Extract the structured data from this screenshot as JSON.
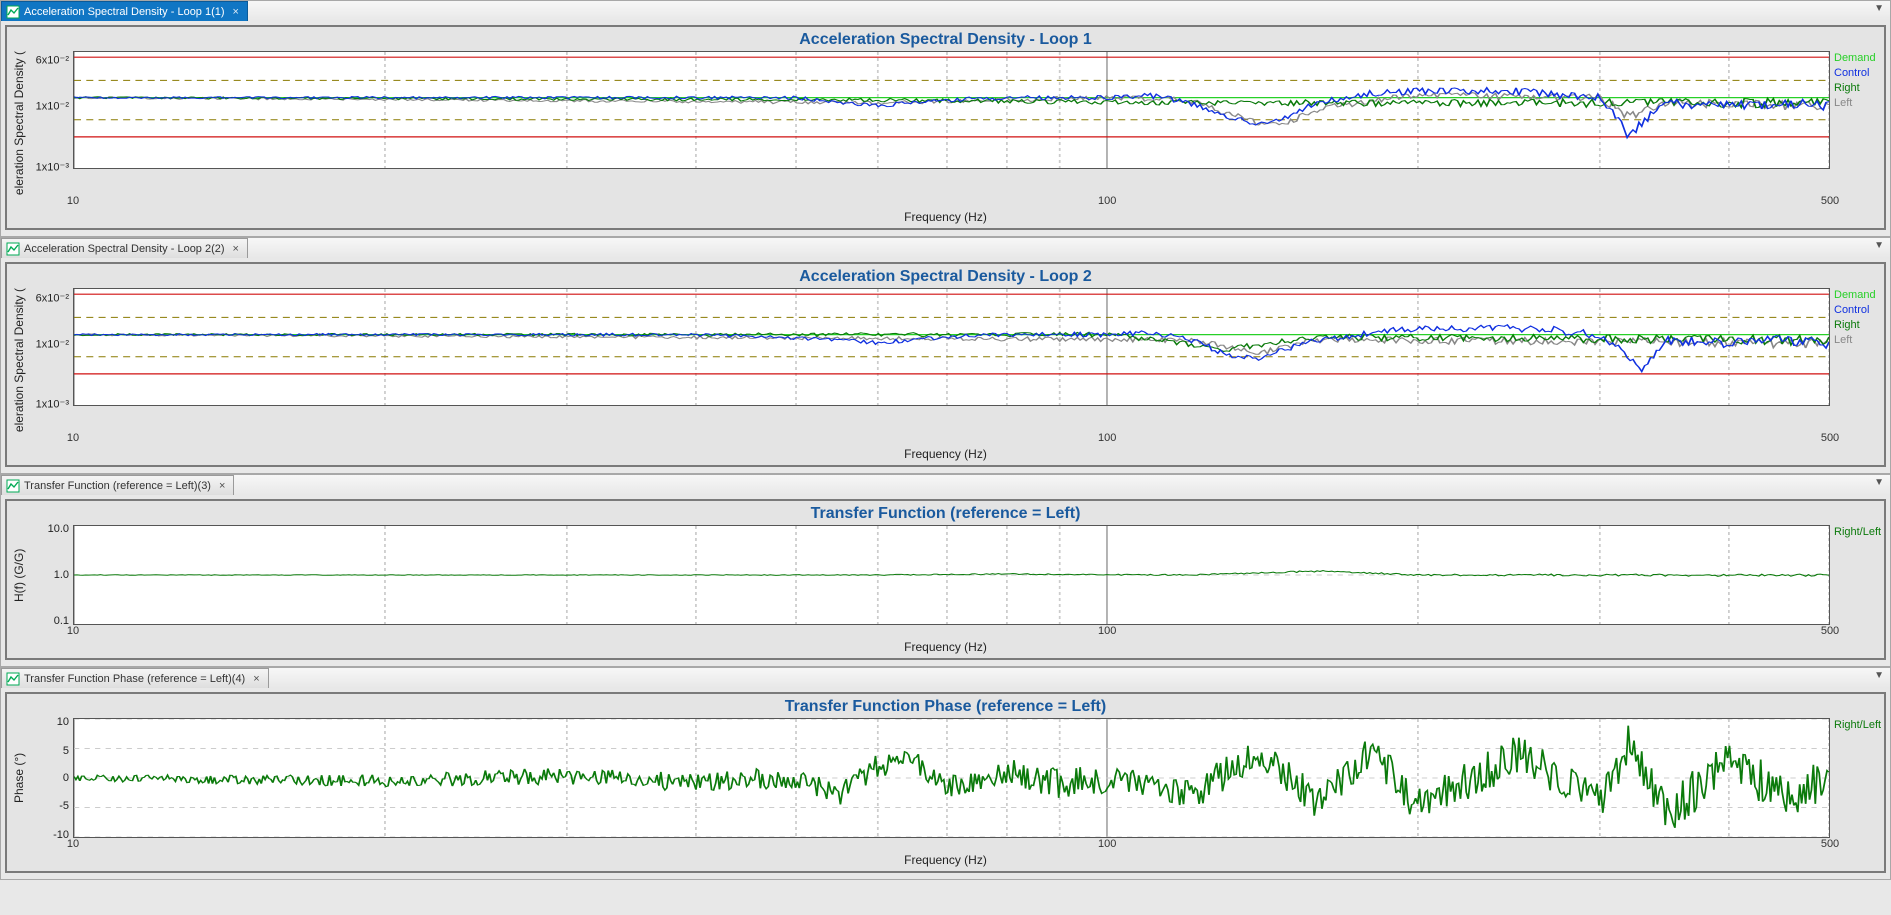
{
  "panels": [
    {
      "tab": {
        "active": true,
        "label": "Acceleration Spectral Density - Loop 1(1)"
      },
      "title": "Acceleration Spectral Density - Loop 1",
      "ylabel": "eleration Spectral Density (",
      "xlabel": "Frequency (Hz)",
      "legend": [
        {
          "label": "Demand",
          "color": "#27d027"
        },
        {
          "label": "Control",
          "color": "#1030e0"
        },
        {
          "label": "Right",
          "color": "#0b7a0b"
        },
        {
          "label": "Left",
          "color": "#888888"
        }
      ],
      "yticks": [
        "6x10⁻²",
        "1x10⁻²",
        "1x10⁻³"
      ],
      "xticks": [
        "10",
        "100",
        "500"
      ]
    },
    {
      "tab": {
        "active": false,
        "label": "Acceleration Spectral Density - Loop 2(2)"
      },
      "title": "Acceleration Spectral Density - Loop 2",
      "ylabel": "eleration Spectral Density (",
      "xlabel": "Frequency (Hz)",
      "legend": [
        {
          "label": "Demand",
          "color": "#27d027"
        },
        {
          "label": "Control",
          "color": "#1030e0"
        },
        {
          "label": "Right",
          "color": "#0b7a0b"
        },
        {
          "label": "Left",
          "color": "#888888"
        }
      ],
      "yticks": [
        "6x10⁻²",
        "1x10⁻²",
        "1x10⁻³"
      ],
      "xticks": [
        "10",
        "100",
        "500"
      ]
    },
    {
      "tab": {
        "active": false,
        "label": "Transfer Function (reference = Left)(3)"
      },
      "title": "Transfer Function (reference = Left)",
      "ylabel": "H(f) (G/G)",
      "xlabel": "Frequency (Hz)",
      "legend": [
        {
          "label": "Right/Left",
          "color": "#0b7a0b"
        }
      ],
      "yticks": [
        "10.0",
        "1.0",
        "0.1"
      ],
      "xticks": [
        "10",
        "100",
        "500"
      ]
    },
    {
      "tab": {
        "active": false,
        "label": "Transfer Function Phase (reference = Left)(4)"
      },
      "title": "Transfer Function Phase (reference = Left)",
      "ylabel": "Phase (°)",
      "xlabel": "Frequency (Hz)",
      "legend": [
        {
          "label": "Right/Left",
          "color": "#0b7a0b"
        }
      ],
      "yticks": [
        "10",
        "5",
        "0",
        "-5",
        "-10"
      ],
      "xticks": [
        "10",
        "100",
        "500"
      ]
    }
  ],
  "chart_data": [
    {
      "type": "line",
      "title": "Acceleration Spectral Density - Loop 1",
      "xlabel": "Frequency (Hz)",
      "ylabel": "Acceleration Spectral Density",
      "xscale": "log",
      "yscale": "log",
      "xlim": [
        10,
        500
      ],
      "ylim": [
        0.001,
        0.06
      ],
      "abort_limits": [
        0.05,
        0.003
      ],
      "alarm_limits": [
        0.022,
        0.0055
      ],
      "demand": 0.012,
      "series": [
        {
          "name": "Control",
          "color": "#1030e0",
          "x": [
            10,
            20,
            30,
            40,
            50,
            55,
            60,
            65,
            70,
            80,
            90,
            100,
            110,
            120,
            130,
            140,
            150,
            160,
            180,
            200,
            250,
            300,
            310,
            320,
            330,
            350,
            400,
            450,
            500
          ],
          "y": [
            0.012,
            0.012,
            0.012,
            0.012,
            0.012,
            0.01,
            0.009,
            0.01,
            0.011,
            0.012,
            0.012,
            0.012,
            0.013,
            0.01,
            0.006,
            0.005,
            0.006,
            0.01,
            0.014,
            0.015,
            0.015,
            0.012,
            0.006,
            0.003,
            0.005,
            0.01,
            0.009,
            0.01,
            0.009
          ]
        },
        {
          "name": "Right",
          "color": "#0b7a0b",
          "x": [
            10,
            60,
            120,
            150,
            500
          ],
          "y": [
            0.012,
            0.011,
            0.01,
            0.01,
            0.01
          ]
        },
        {
          "name": "Left",
          "color": "#888888",
          "x": [
            10,
            60,
            100,
            120,
            130,
            140,
            150,
            160,
            200,
            300,
            320,
            350,
            500
          ],
          "y": [
            0.012,
            0.01,
            0.012,
            0.011,
            0.007,
            0.005,
            0.005,
            0.008,
            0.013,
            0.012,
            0.006,
            0.01,
            0.009
          ]
        }
      ]
    },
    {
      "type": "line",
      "title": "Acceleration Spectral Density - Loop 2",
      "xlabel": "Frequency (Hz)",
      "ylabel": "Acceleration Spectral Density",
      "xscale": "log",
      "yscale": "log",
      "xlim": [
        10,
        500
      ],
      "ylim": [
        0.001,
        0.06
      ],
      "abort_limits": [
        0.05,
        0.003
      ],
      "alarm_limits": [
        0.022,
        0.0055
      ],
      "demand": 0.012,
      "series": [
        {
          "name": "Control",
          "color": "#1030e0",
          "x": [
            10,
            20,
            40,
            55,
            60,
            70,
            80,
            100,
            110,
            120,
            130,
            140,
            160,
            200,
            260,
            300,
            320,
            330,
            350,
            400,
            450,
            500
          ],
          "y": [
            0.012,
            0.012,
            0.012,
            0.01,
            0.009,
            0.011,
            0.012,
            0.012,
            0.013,
            0.01,
            0.006,
            0.005,
            0.01,
            0.015,
            0.015,
            0.012,
            0.005,
            0.003,
            0.01,
            0.009,
            0.01,
            0.009
          ]
        },
        {
          "name": "Right",
          "color": "#0b7a0b",
          "x": [
            10,
            100,
            130,
            160,
            500
          ],
          "y": [
            0.012,
            0.012,
            0.007,
            0.011,
            0.01
          ]
        },
        {
          "name": "Left",
          "color": "#888888",
          "x": [
            10,
            120,
            140,
            160,
            500
          ],
          "y": [
            0.012,
            0.01,
            0.006,
            0.01,
            0.009
          ]
        }
      ]
    },
    {
      "type": "line",
      "title": "Transfer Function (reference = Left)",
      "xlabel": "Frequency (Hz)",
      "ylabel": "H(f) (G/G)",
      "xscale": "log",
      "yscale": "log",
      "xlim": [
        10,
        500
      ],
      "ylim": [
        0.1,
        10.0
      ],
      "series": [
        {
          "name": "Right/Left",
          "color": "#0b7a0b",
          "x": [
            10,
            30,
            60,
            80,
            100,
            120,
            140,
            160,
            180,
            200,
            250,
            300,
            350,
            400,
            450,
            500
          ],
          "y": [
            1.0,
            1.0,
            1.0,
            1.05,
            1.02,
            1.0,
            1.1,
            1.2,
            1.1,
            1.0,
            1.0,
            1.0,
            1.0,
            0.98,
            1.0,
            1.0
          ]
        }
      ]
    },
    {
      "type": "line",
      "title": "Transfer Function Phase (reference = Left)",
      "xlabel": "Frequency (Hz)",
      "ylabel": "Phase (°)",
      "xscale": "log",
      "yscale": "linear",
      "xlim": [
        10,
        500
      ],
      "ylim": [
        -10,
        10
      ],
      "series": [
        {
          "name": "Right/Left",
          "color": "#0b7a0b",
          "x": [
            10,
            20,
            30,
            40,
            50,
            55,
            60,
            65,
            70,
            80,
            90,
            100,
            120,
            140,
            160,
            180,
            200,
            250,
            300,
            320,
            350,
            400,
            450,
            500
          ],
          "y": [
            0,
            -0.5,
            0.4,
            -0.8,
            0.2,
            -3,
            2,
            3,
            -2,
            1,
            -1,
            0,
            -3,
            4,
            -4,
            5,
            -5,
            4,
            -4,
            6,
            -6,
            3,
            -3,
            0
          ]
        }
      ]
    }
  ]
}
